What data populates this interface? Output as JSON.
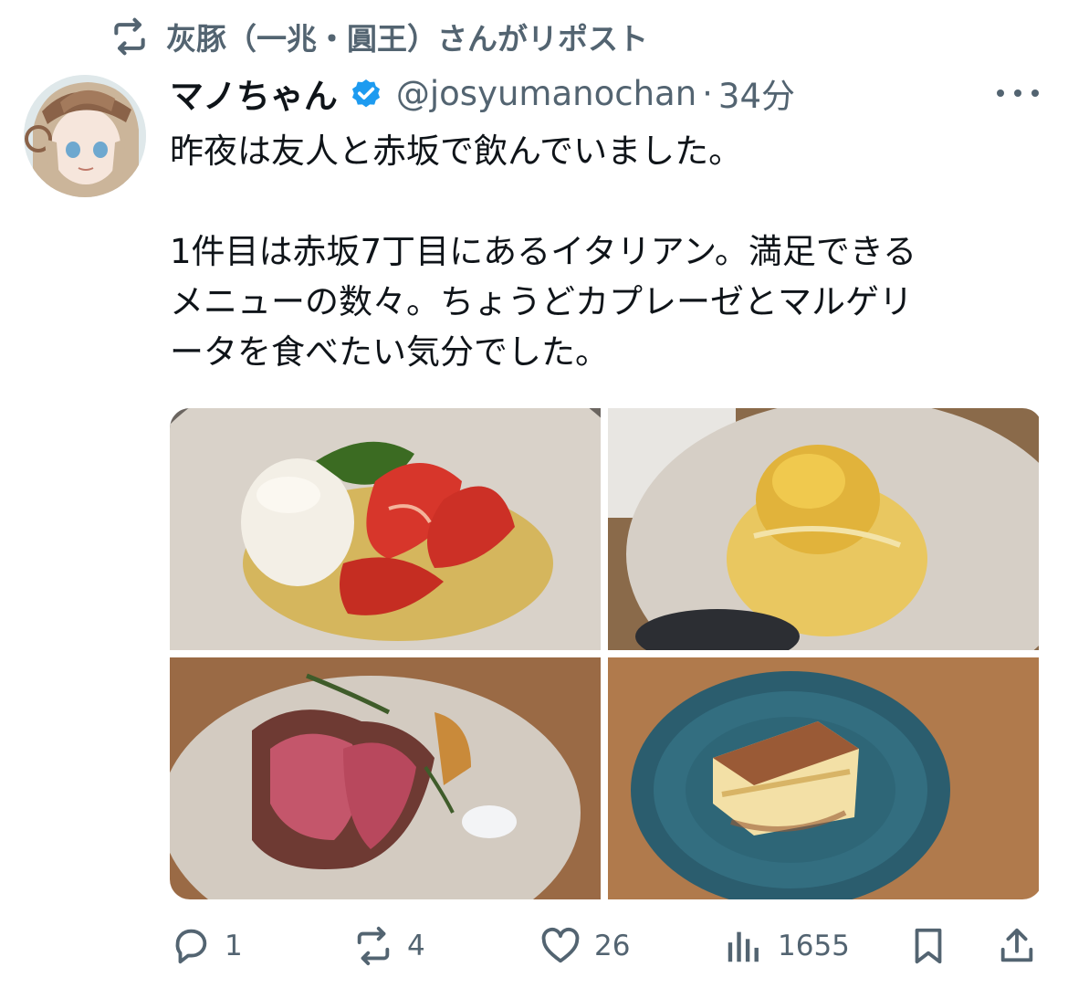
{
  "repost": {
    "text": "灰豚（一兆・圓王）さんがリポスト",
    "icon": "repost-icon"
  },
  "author": {
    "display_name": "マノちゃん",
    "handle": "@josyumanochan",
    "separator": "·",
    "time": "34分",
    "verified": true,
    "verified_color": "#1d9bf0"
  },
  "tweet": {
    "line1": "昨夜は友人と赤坂で飲んでいました。",
    "line2": "1件目は赤坂7丁目にあるイタリアン。満足できる\nメニューの数々。ちょうどカプレーゼとマルゲリ\nータを食べたい気分でした。"
  },
  "media": [
    "burrata-caprese-photo",
    "pasta-photo",
    "roast-beef-photo",
    "tiramisu-photo"
  ],
  "actions": {
    "replies": "1",
    "reposts": "4",
    "likes": "26",
    "views": "1655"
  },
  "colors": {
    "text": "#0f1419",
    "muted": "#536471",
    "accent": "#1d9bf0"
  }
}
